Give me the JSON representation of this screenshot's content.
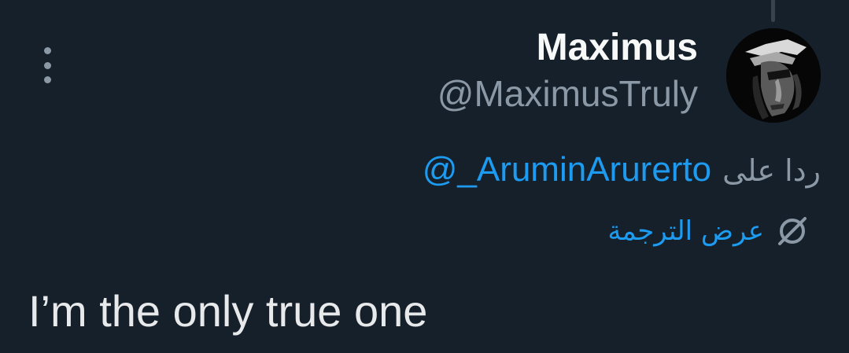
{
  "tweet": {
    "author": {
      "display_name": "Maximus",
      "handle": "@MaximusTruly",
      "avatar_icon": "statue-face-avatar"
    },
    "reply_to": {
      "prefix": "ردا على",
      "mention": "@_AruminArurerto"
    },
    "translate": {
      "label": "عرض الترجمة",
      "icon": "globe-translate-icon"
    },
    "text": "I’m the only true one",
    "more_icon": "more-vertical-icon"
  },
  "colors": {
    "background": "#15202b",
    "accent": "#1d9bf0",
    "secondary_text": "#8b98a5",
    "primary_text": "#e7e9ea"
  }
}
